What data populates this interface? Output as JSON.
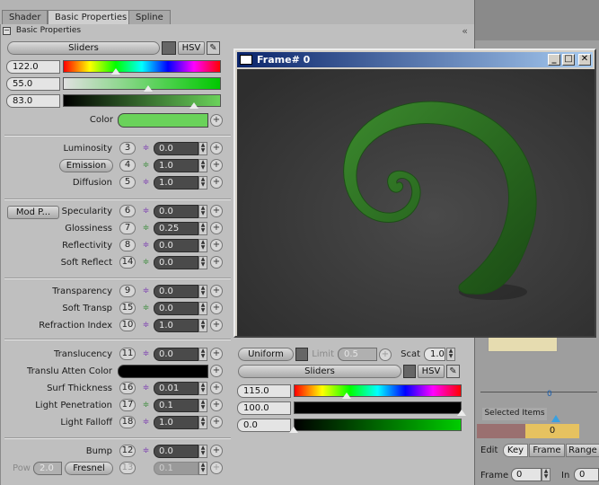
{
  "tabs": [
    "Shader",
    "Basic Properties",
    "Spline"
  ],
  "section_title": "Basic Properties",
  "color_mode": {
    "mode_label": "Sliders",
    "hsv_label": "HSV"
  },
  "hsv_values": [
    "122.0",
    "55.0",
    "83.0"
  ],
  "color_label": "Color",
  "group1": [
    {
      "label": "Luminosity",
      "num": "3",
      "value": "0.0"
    },
    {
      "label": "Emission",
      "num": "4",
      "value": "1.0"
    },
    {
      "label": "Diffusion",
      "num": "5",
      "value": "1.0"
    }
  ],
  "group2": {
    "mod_button": "Mod P...",
    "rows": [
      {
        "label": "Specularity",
        "num": "6",
        "value": "0.0"
      },
      {
        "label": "Glossiness",
        "num": "7",
        "value": "0.25"
      },
      {
        "label": "Reflectivity",
        "num": "8",
        "value": "0.0"
      },
      {
        "label": "Soft Reflect",
        "num": "14",
        "value": "0.0"
      }
    ]
  },
  "group3": [
    {
      "label": "Transparency",
      "num": "9",
      "value": "0.0"
    },
    {
      "label": "Soft Transp",
      "num": "15",
      "value": "0.0"
    },
    {
      "label": "Refraction Index",
      "num": "10",
      "value": "1.0"
    }
  ],
  "group4": [
    {
      "label": "Translucency",
      "num": "11",
      "value": "0.0"
    },
    {
      "label": "Translu Atten Color",
      "num": "",
      "value": ""
    },
    {
      "label": "Surf Thickness",
      "num": "16",
      "value": "0.01"
    },
    {
      "label": "Light Penetration",
      "num": "17",
      "value": "0.1"
    },
    {
      "label": "Light Falloff",
      "num": "18",
      "value": "1.0"
    }
  ],
  "group5": [
    {
      "label": "Bump",
      "num": "12",
      "value": "0.0"
    }
  ],
  "pow_row": {
    "pow_label": "Pow",
    "pow_value": "2.0",
    "fresnel_label": "Fresnel",
    "num": "13",
    "value": "0.1"
  },
  "translu_panel": {
    "uniform_label": "Uniform",
    "limit_label": "Limit",
    "limit_value": "0.5",
    "scat_label": "Scat",
    "scat_value": "1.0",
    "sliders_label": "Sliders",
    "hsv_label": "HSV",
    "values": [
      "115.0",
      "100.0",
      "0.0"
    ]
  },
  "preview": {
    "title": "Frame# 0"
  },
  "timeline": {
    "ruler_value": "0",
    "selected_items_label": "Selected Items",
    "selected_value": "0",
    "edit_label": "Edit",
    "tabs": [
      "Key",
      "Frame",
      "Range"
    ],
    "frame_label": "Frame",
    "frame_value": "0",
    "in_label": "In",
    "in_value": "0"
  },
  "colors": {
    "surface_color": "#6ad25a",
    "accent": "#0a246a"
  }
}
